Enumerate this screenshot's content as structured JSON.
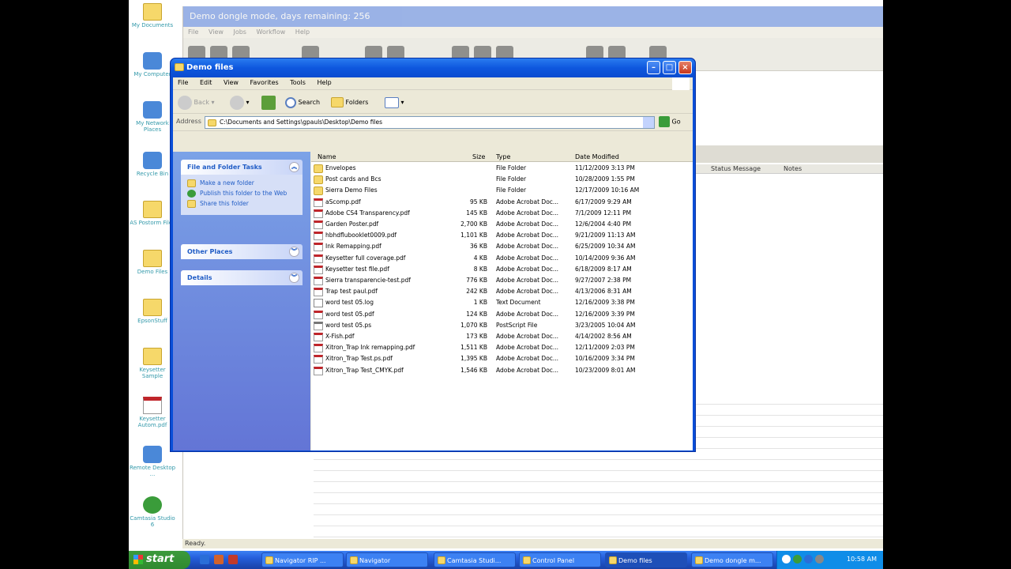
{
  "desktop": {
    "icons": [
      {
        "label": "My Documents",
        "icon": "folder-icon"
      },
      {
        "label": "My Computer",
        "icon": "computer-icon"
      },
      {
        "label": "My Network Places",
        "icon": "network-icon"
      },
      {
        "label": "Recycle Bin",
        "icon": "recycle-bin-icon"
      },
      {
        "label": "AS Postorm Files",
        "icon": "folder-icon"
      },
      {
        "label": "Demo Files",
        "icon": "folder-icon"
      },
      {
        "label": "EpsonStuff",
        "icon": "folder-icon"
      },
      {
        "label": "Keysetter Sample",
        "icon": "folder-icon"
      },
      {
        "label": "Keysetter Autom.pdf",
        "icon": "pdf-icon"
      },
      {
        "label": "Remote Desktop ...",
        "icon": "remote-desktop-icon"
      },
      {
        "label": "Camtasia Studio 6",
        "icon": "camtasia-icon"
      }
    ]
  },
  "background_app": {
    "title": "Demo dongle mode, days remaining: 256",
    "menu": [
      "File",
      "View",
      "Jobs",
      "Workflow",
      "Help"
    ],
    "grid_columns": [
      "Status Message",
      "Notes"
    ],
    "status": "Ready."
  },
  "window": {
    "title": "Demo files",
    "menu": [
      "File",
      "Edit",
      "View",
      "Favorites",
      "Tools",
      "Help"
    ],
    "toolbar": {
      "back": "Back",
      "search": "Search",
      "folders": "Folders"
    },
    "address": {
      "label": "Address",
      "value": "C:\\Documents and Settings\\gpauls\\Desktop\\Demo files",
      "go": "Go"
    },
    "tasks": {
      "file_folder_title": "File and Folder Tasks",
      "items": [
        "Make a new folder",
        "Publish this folder to the Web",
        "Share this folder"
      ],
      "other_places": "Other Places",
      "details": "Details"
    },
    "columns": {
      "name": "Name",
      "size": "Size",
      "type": "Type",
      "date": "Date Modified"
    },
    "files": [
      {
        "name": "Envelopes",
        "size": "",
        "type": "File Folder",
        "date": "11/12/2009 3:13 PM",
        "kind": "folder"
      },
      {
        "name": "Post cards and Bcs",
        "size": "",
        "type": "File Folder",
        "date": "10/28/2009 1:55 PM",
        "kind": "folder"
      },
      {
        "name": "Sierra Demo Files",
        "size": "",
        "type": "File Folder",
        "date": "12/17/2009 10:16 AM",
        "kind": "folder"
      },
      {
        "name": "aScomp.pdf",
        "size": "95 KB",
        "type": "Adobe Acrobat Doc...",
        "date": "6/17/2009 9:29 AM",
        "kind": "pdf"
      },
      {
        "name": "Adobe CS4 Transparency.pdf",
        "size": "145 KB",
        "type": "Adobe Acrobat Doc...",
        "date": "7/1/2009 12:11 PM",
        "kind": "pdf"
      },
      {
        "name": "Garden Poster.pdf",
        "size": "2,700 KB",
        "type": "Adobe Acrobat Doc...",
        "date": "12/6/2004 4:40 PM",
        "kind": "pdf"
      },
      {
        "name": "hbhdflubooklet0009.pdf",
        "size": "1,101 KB",
        "type": "Adobe Acrobat Doc...",
        "date": "9/21/2009 11:13 AM",
        "kind": "pdf"
      },
      {
        "name": "Ink Remapping.pdf",
        "size": "36 KB",
        "type": "Adobe Acrobat Doc...",
        "date": "6/25/2009 10:34 AM",
        "kind": "pdf"
      },
      {
        "name": "Keysetter full coverage.pdf",
        "size": "4 KB",
        "type": "Adobe Acrobat Doc...",
        "date": "10/14/2009 9:36 AM",
        "kind": "pdf"
      },
      {
        "name": "Keysetter test file.pdf",
        "size": "8 KB",
        "type": "Adobe Acrobat Doc...",
        "date": "6/18/2009 8:17 AM",
        "kind": "pdf"
      },
      {
        "name": "Sierra transparencie-test.pdf",
        "size": "776 KB",
        "type": "Adobe Acrobat Doc...",
        "date": "9/27/2007 2:38 PM",
        "kind": "pdf"
      },
      {
        "name": "Trap test paul.pdf",
        "size": "242 KB",
        "type": "Adobe Acrobat Doc...",
        "date": "4/13/2006 8:31 AM",
        "kind": "pdf"
      },
      {
        "name": "word test 05.log",
        "size": "1 KB",
        "type": "Text Document",
        "date": "12/16/2009 3:38 PM",
        "kind": "txt"
      },
      {
        "name": "word test 05.pdf",
        "size": "124 KB",
        "type": "Adobe Acrobat Doc...",
        "date": "12/16/2009 3:39 PM",
        "kind": "pdf"
      },
      {
        "name": "word test 05.ps",
        "size": "1,070 KB",
        "type": "PostScript File",
        "date": "3/23/2005 10:04 AM",
        "kind": "ps"
      },
      {
        "name": "X-Fish.pdf",
        "size": "173 KB",
        "type": "Adobe Acrobat Doc...",
        "date": "4/14/2002 8:56 AM",
        "kind": "pdf"
      },
      {
        "name": "Xitron_Trap Ink remapping.pdf",
        "size": "1,511 KB",
        "type": "Adobe Acrobat Doc...",
        "date": "12/11/2009 2:03 PM",
        "kind": "pdf"
      },
      {
        "name": "Xitron_Trap Test.ps.pdf",
        "size": "1,395 KB",
        "type": "Adobe Acrobat Doc...",
        "date": "10/16/2009 3:34 PM",
        "kind": "pdf"
      },
      {
        "name": "Xitron_Trap Test_CMYK.pdf",
        "size": "1,546 KB",
        "type": "Adobe Acrobat Doc...",
        "date": "10/23/2009 8:01 AM",
        "kind": "pdf"
      }
    ]
  },
  "taskbar": {
    "start": "start",
    "tasks": [
      {
        "label": "Navigator RIP ...",
        "active": false
      },
      {
        "label": "Navigator",
        "active": false
      },
      {
        "label": "Camtasia Studi...",
        "active": false
      },
      {
        "label": "Control Panel",
        "active": false
      },
      {
        "label": "Demo files",
        "active": true
      },
      {
        "label": "Demo dongle m...",
        "active": false
      }
    ],
    "clock": "10:58 AM"
  }
}
